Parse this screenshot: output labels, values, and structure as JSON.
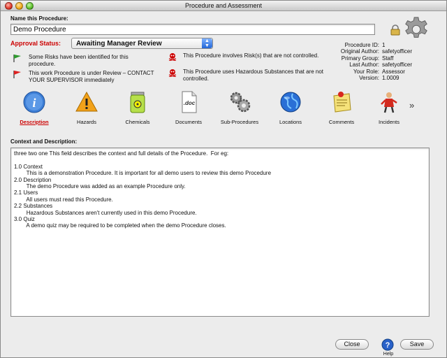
{
  "window": {
    "title": "Procedure and Assessment"
  },
  "name_section": {
    "label": "Name this Procedure:",
    "value": "Demo Procedure"
  },
  "approval": {
    "label": "Approval Status:",
    "selected": "Awaiting Manager Review"
  },
  "notices": [
    {
      "icon": "green-flag-icon",
      "text": "Some Risks have been identified for this procedure."
    },
    {
      "icon": "red-flag-icon",
      "text": "This work Procedure is under Review – CONTACT YOUR SUPERVISOR immediately"
    },
    {
      "icon": "skull-icon",
      "text": "This Procedure involves Risk(s) that are not controlled."
    },
    {
      "icon": "skull-icon",
      "text": "This Procedure uses Hazardous Substances that are not controlled."
    }
  ],
  "meta": [
    {
      "key": "Procedure ID:",
      "value": "1"
    },
    {
      "key": "Original Author:",
      "value": "safetyofficer"
    },
    {
      "key": "Primary Group:",
      "value": "Staff"
    },
    {
      "key": "Last Author:",
      "value": "safetyofficer"
    },
    {
      "key": "Your Role:",
      "value": "Assessor"
    },
    {
      "key": "Version:",
      "value": "1.0009"
    }
  ],
  "toolbar": {
    "items": [
      {
        "label": "Description",
        "icon": "info-icon",
        "active": true
      },
      {
        "label": "Hazards",
        "icon": "warning-icon"
      },
      {
        "label": "Chemicals",
        "icon": "chemical-icon"
      },
      {
        "label": "Documents",
        "icon": "document-icon"
      },
      {
        "label": "Sub-Procedures",
        "icon": "gears-icon"
      },
      {
        "label": "Locations",
        "icon": "globe-icon"
      },
      {
        "label": "Comments",
        "icon": "note-icon"
      },
      {
        "label": "Incidents",
        "icon": "incident-icon"
      }
    ],
    "more": "»"
  },
  "context": {
    "label": "Context and Description:",
    "text": "three two one This field describes the context and full details of the Procedure.  For eg:\n\n1.0 Context\n        This is a demonstration Procedure. It is important for all demo users to review this demo Procedure\n2.0 Description\n        The demo Procedure was added as an example Procedure only.\n2.1 Users\n        All users must read this Procedure.\n2.2 Substances\n        Hazardous Substances aren't currently used in this demo Procedure.\n3.0 Quiz\n        A demo quiz may be required to be completed when the demo Procedure closes."
  },
  "buttons": {
    "close": "Close",
    "help": "Help",
    "save": "Save"
  },
  "colors": {
    "accent_red": "#cc0000",
    "select_arrow": "#2266d6"
  }
}
